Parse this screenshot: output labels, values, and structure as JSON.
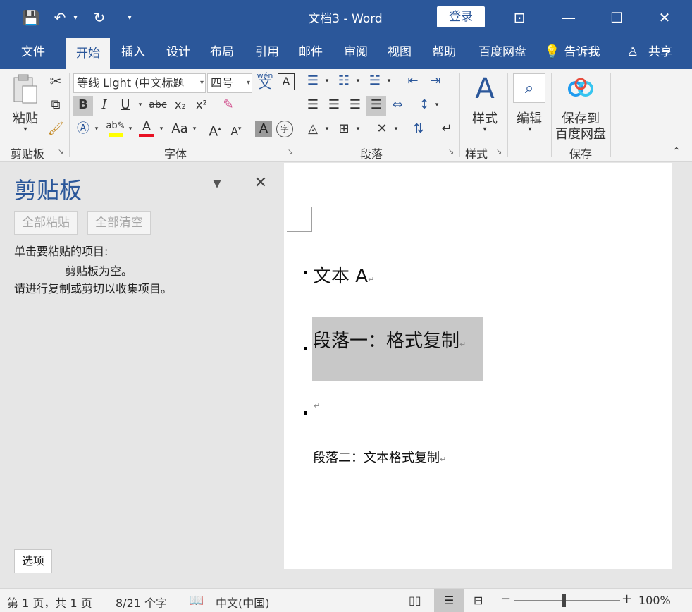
{
  "titlebar": {
    "document": "文档3  -  Word",
    "login": "登录",
    "quick_access": [
      "💾",
      "↶",
      "▾",
      "↻",
      "▾"
    ],
    "window_controls": [
      "⊡",
      "—",
      "☐",
      "✕"
    ]
  },
  "tabs": [
    "文件",
    "开始",
    "插入",
    "设计",
    "布局",
    "引用",
    "邮件",
    "审阅",
    "视图",
    "帮助",
    "百度网盘",
    "告诉我",
    "共享"
  ],
  "ribbon": {
    "clipboard": {
      "paste": "粘贴",
      "label": "剪贴板"
    },
    "font": {
      "font_name": "等线 Light (中文标题",
      "font_size": "四号",
      "bold": "B",
      "italic": "I",
      "underline": "U",
      "strike": "abc",
      "subscript": "x₂",
      "superscript": "x²",
      "case": "Aa",
      "grow": "A",
      "shrink": "A",
      "wen": "wén",
      "label": "字体"
    },
    "paragraph": {
      "label": "段落"
    },
    "styles": {
      "button": "样式",
      "label": "样式"
    },
    "editing": {
      "button": "编辑"
    },
    "save": {
      "button_line1": "保存到",
      "button_line2": "百度网盘",
      "label": "保存"
    }
  },
  "pane": {
    "title": "剪贴板",
    "paste_all": "全部粘贴",
    "clear_all": "全部清空",
    "instruction": "单击要粘贴的项目:",
    "empty": "剪贴板为空。",
    "hint": "请进行复制或剪切以收集项目。",
    "options": "选项"
  },
  "document": {
    "para1": "文本 A",
    "para2": "段落一：格式复制",
    "para4": "段落二：文本格式复制",
    "para_mark": "↵"
  },
  "status": {
    "page": "第 1 页，共 1 页",
    "words": "8/21 个字",
    "language": "中文(中国)",
    "zoom": "100%"
  },
  "colors": {
    "accent": "#2b579a",
    "highlight": "#c8c8c8",
    "font_color": "#e81123",
    "highlight_color": "#ffff00"
  }
}
